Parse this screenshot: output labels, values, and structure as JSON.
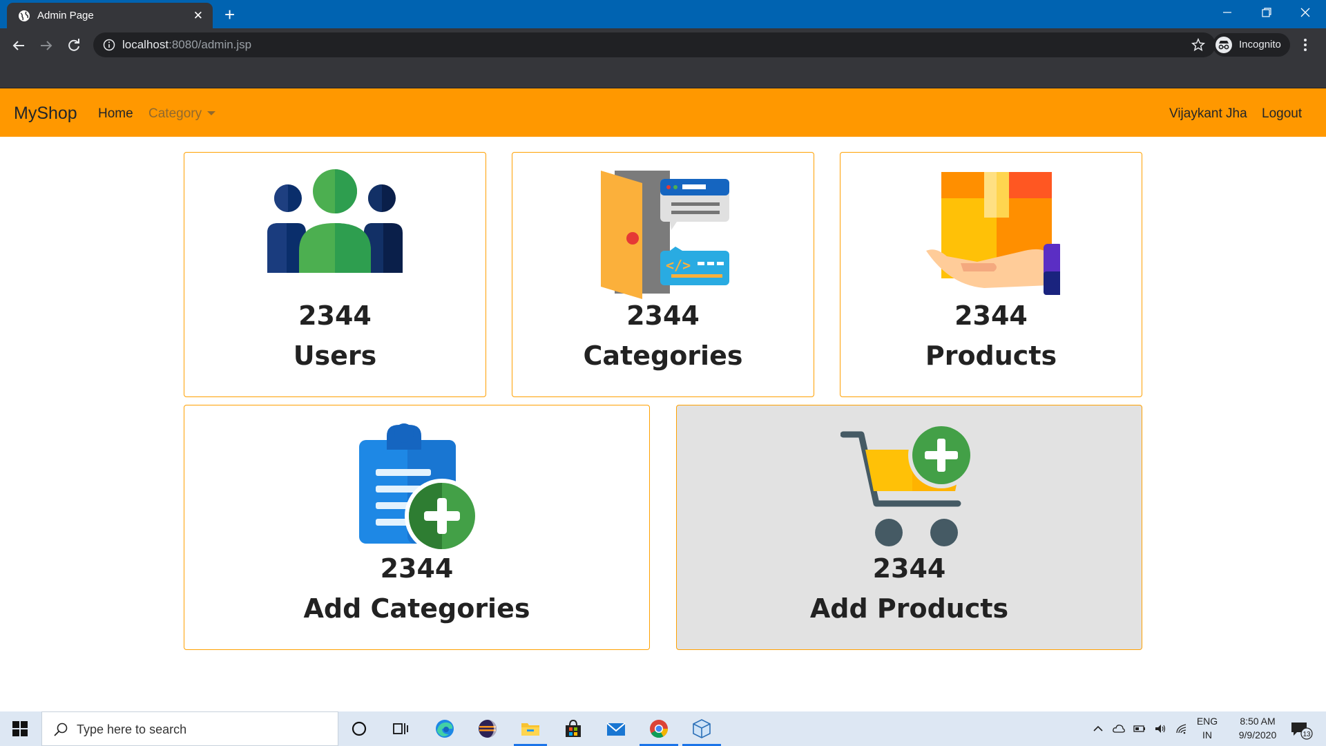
{
  "browser": {
    "tab_title": "Admin Page",
    "url_host": "localhost",
    "url_rest": ":8080/admin.jsp",
    "profile_label": "Incognito"
  },
  "navbar": {
    "brand": "MyShop",
    "home": "Home",
    "category": "Category",
    "user": "Vijaykant Jha",
    "logout": "Logout",
    "color": "#ff9800"
  },
  "cards": {
    "users": {
      "count": "2344",
      "label": "Users",
      "icon": "users-icon"
    },
    "categories": {
      "count": "2344",
      "label": "Categories",
      "icon": "category-door-icon"
    },
    "products": {
      "count": "2344",
      "label": "Products",
      "icon": "product-box-icon"
    },
    "add_categories": {
      "count": "2344",
      "label": "Add Categories",
      "icon": "clipboard-add-icon"
    },
    "add_products": {
      "count": "2344",
      "label": "Add Products",
      "icon": "cart-add-icon"
    }
  },
  "taskbar": {
    "search_placeholder": "Type here to search",
    "lang_top": "ENG",
    "lang_bottom": "IN",
    "time": "8:50 AM",
    "date": "9/9/2020",
    "notification_count": "13"
  }
}
